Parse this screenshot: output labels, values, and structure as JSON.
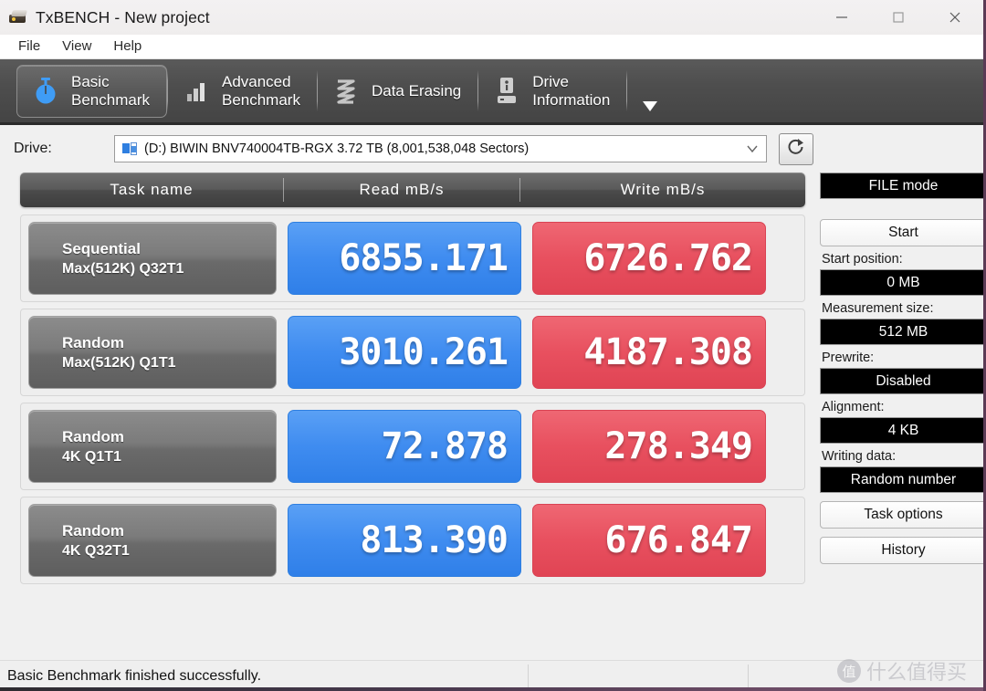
{
  "window": {
    "title": "TxBENCH - New project",
    "icon": "drive-stack-icon",
    "controls": {
      "minimize": "minimize-icon",
      "maximize": "maximize-icon",
      "close": "close-icon"
    }
  },
  "menu": {
    "items": [
      "File",
      "View",
      "Help"
    ]
  },
  "toolbar": {
    "tabs": [
      {
        "label": "Basic\nBenchmark",
        "icon": "stopwatch-icon",
        "active": true
      },
      {
        "label": "Advanced\nBenchmark",
        "icon": "bar-chart-icon",
        "active": false
      },
      {
        "label": "Data Erasing",
        "icon": "shredder-icon",
        "active": false
      },
      {
        "label": "Drive\nInformation",
        "icon": "drive-info-icon",
        "active": false
      }
    ],
    "overflow": "chevron-down-icon"
  },
  "drive": {
    "label": "Drive:",
    "selected": "(D:) BIWIN BNV740004TB-RGX  3.72 TB (8,001,538,048 Sectors)",
    "icon": "drive-icon",
    "dropdown_icon": "chevron-down-icon",
    "refresh_icon": "refresh-icon"
  },
  "results": {
    "headers": [
      "Task name",
      "Read mB/s",
      "Write mB/s"
    ],
    "rows": [
      {
        "task_main": "Sequential",
        "task_sub": "Max(512K) Q32T1",
        "read": "6855.171",
        "write": "6726.762"
      },
      {
        "task_main": "Random",
        "task_sub": "Max(512K) Q1T1",
        "read": "3010.261",
        "write": "4187.308"
      },
      {
        "task_main": "Random",
        "task_sub": "4K Q1T1",
        "read": "72.878",
        "write": "278.349"
      },
      {
        "task_main": "Random",
        "task_sub": "4K Q32T1",
        "read": "813.390",
        "write": "676.847"
      }
    ]
  },
  "sidebar": {
    "mode_button": "FILE mode",
    "start_button": "Start",
    "start_position_label": "Start position:",
    "start_position_value": "0 MB",
    "measurement_size_label": "Measurement size:",
    "measurement_size_value": "512 MB",
    "prewrite_label": "Prewrite:",
    "prewrite_value": "Disabled",
    "alignment_label": "Alignment:",
    "alignment_value": "4 KB",
    "writing_data_label": "Writing data:",
    "writing_data_value": "Random number",
    "task_options_button": "Task options",
    "history_button": "History"
  },
  "statusbar": {
    "message": "Basic Benchmark finished successfully."
  },
  "watermark": {
    "mark": "值",
    "text": "什么值得买"
  },
  "colors": {
    "read_blue": "#3f8cf0",
    "write_red": "#e8505f",
    "toolbar_dark": "#4e4e4e",
    "task_gray": "#7b7b7b",
    "window_bg": "#f0f0f0"
  }
}
